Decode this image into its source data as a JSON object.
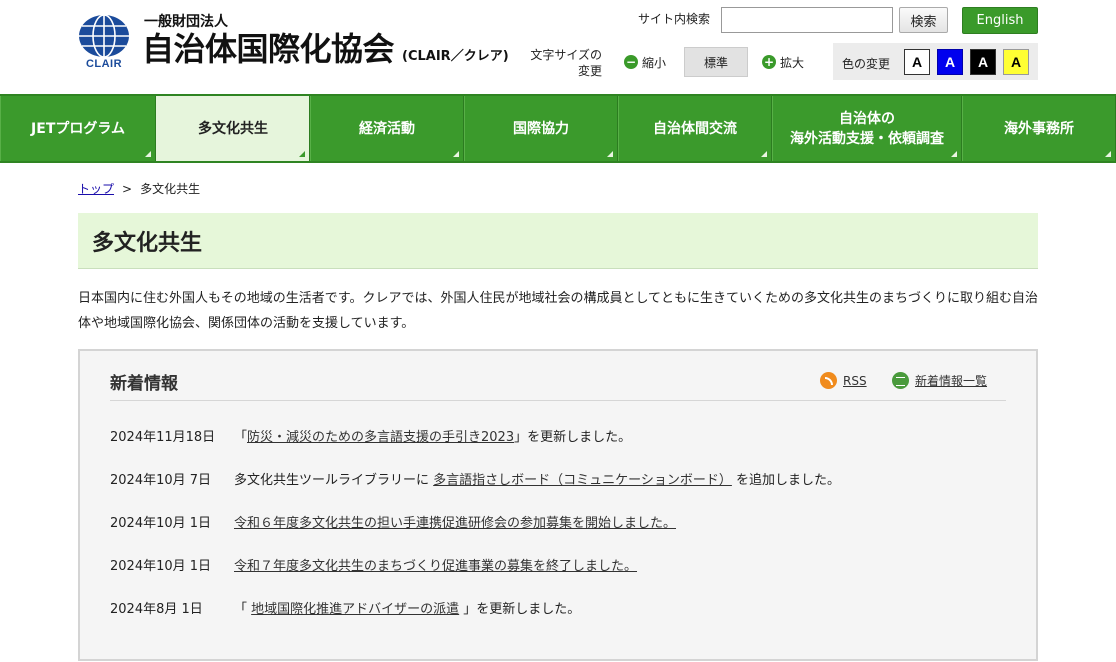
{
  "header": {
    "org_type": "一般財団法人",
    "org_name": "自治体国際化協会",
    "org_short": "(CLAIR／クレア)",
    "logo_text": "CLAIR",
    "search_label": "サイト内検索",
    "search_value": "",
    "search_button": "検索",
    "english_button": "English",
    "font_size_label": "文字サイズの変更",
    "font_small": "縮小",
    "font_normal": "標準",
    "font_large": "拡大",
    "color_label": "色の変更",
    "color_options": [
      "A",
      "A",
      "A",
      "A"
    ]
  },
  "nav": {
    "items": [
      {
        "label": "JETプログラム"
      },
      {
        "label": "多文化共生",
        "active": true
      },
      {
        "label": "経済活動"
      },
      {
        "label": "国際協力"
      },
      {
        "label": "自治体間交流"
      },
      {
        "label": "自治体の\n海外活動支援・依頼調査"
      },
      {
        "label": "海外事務所"
      }
    ]
  },
  "breadcrumb": {
    "home": "トップ",
    "separator": ">",
    "current": "多文化共生"
  },
  "page": {
    "title": "多文化共生",
    "intro": "日本国内に住む外国人もその地域の生活者です。クレアでは、外国人住民が地域社会の構成員としてともに生きていくための多文化共生のまちづくりに取り組む自治体や地域国際化協会、関係団体の活動を支援しています。"
  },
  "news": {
    "title": "新着情報",
    "rss": "RSS",
    "list_link": "新着情報一覧",
    "items": [
      {
        "date": "2024年11月18日",
        "pre": "「",
        "link": "防災・減災のための多言語支援の手引き2023",
        "post": "」を更新しました。"
      },
      {
        "date": "2024年10月 7日",
        "pre": "多文化共生ツールライブラリーに ",
        "link": "多言語指さしボード（コミュニケーションボード）",
        "post": " を追加しました。"
      },
      {
        "date": "2024年10月 1日",
        "pre": "",
        "link": "令和６年度多文化共生の担い手連携促進研修会の参加募集を開始しました。",
        "post": ""
      },
      {
        "date": "2024年10月 1日",
        "pre": "",
        "link": "令和７年度多文化共生のまちづくり促進事業の募集を終了しました。",
        "post": ""
      },
      {
        "date": "2024年8月 1日",
        "pre": "「 ",
        "link": "地域国際化推進アドバイザーの派遣",
        "post": " 」を更新しました。"
      }
    ]
  },
  "colors": {
    "brand_green": "#3b9a2c",
    "title_bg": "#e6f7d9",
    "logo_blue": "#1b4b9b"
  }
}
